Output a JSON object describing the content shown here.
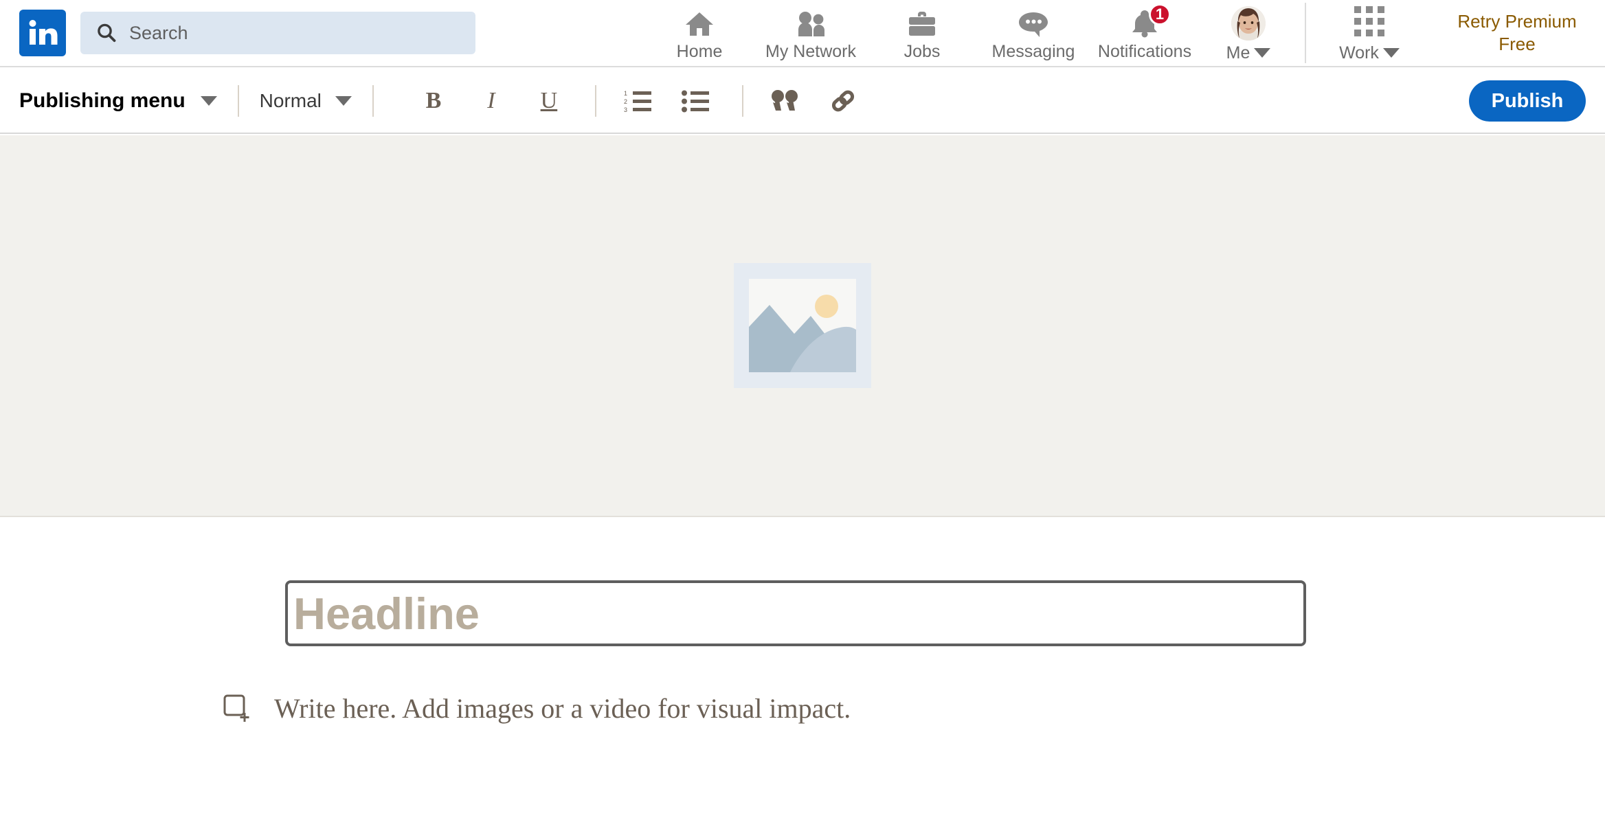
{
  "nav": {
    "logo": "linkedin-logo",
    "search": {
      "placeholder": "Search",
      "value": "",
      "icon": "search-icon"
    },
    "items": [
      {
        "label": "Home",
        "icon": "home-icon",
        "badge": ""
      },
      {
        "label": "My Network",
        "icon": "people-icon",
        "badge": ""
      },
      {
        "label": "Jobs",
        "icon": "briefcase-icon",
        "badge": ""
      },
      {
        "label": "Messaging",
        "icon": "message-bubble-icon",
        "badge": ""
      },
      {
        "label": "Notifications",
        "icon": "bell-icon",
        "badge": "1"
      }
    ],
    "me": {
      "label": "Me",
      "icon": "avatar",
      "caret": "chevron-down-icon"
    },
    "work": {
      "label": "Work",
      "icon": "grid-icon",
      "caret": "chevron-down-icon"
    },
    "premium": {
      "line1": "Retry Premium",
      "line2": "Free",
      "color": "#8a5a00"
    }
  },
  "toolbar": {
    "publishing_menu_label": "Publishing menu",
    "style_label": "Normal",
    "bold_label": "B",
    "italic_label": "I",
    "underline_label": "U",
    "ordered_list_icon": "numbered-list-icon",
    "bullet_list_icon": "bullet-list-icon",
    "quote_icon": "quote-icon",
    "link_icon": "link-icon",
    "publish_label": "Publish",
    "publish_color": "#0a66c2",
    "icon_color": "#6b6055"
  },
  "cover": {
    "placeholder_icon": "image-placeholder-icon",
    "background_color": "#f2f1ed"
  },
  "article": {
    "headline": {
      "placeholder": "Headline",
      "value": "",
      "placeholder_color": "#b8ad9c",
      "border_color": "#5e5e5e"
    },
    "body": {
      "add_media_icon": "add-media-icon",
      "placeholder": "Write here. Add images or a video for visual impact.",
      "value": ""
    }
  }
}
